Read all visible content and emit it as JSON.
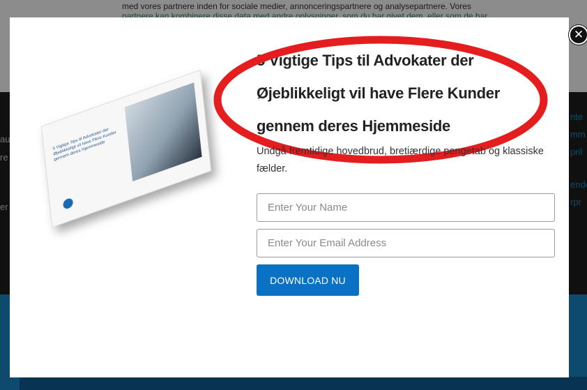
{
  "background": {
    "cookie_text_line1": "",
    "cookie_text_line2": "med vores partnere inden for sociale medier, annonceringspartnere og analysepartnere. Vores",
    "cookie_text_line3": "partnere kan kombinere disse data med andre oplysninger, som du har givet dem, eller som de har",
    "side_left": [
      "au,",
      "re",
      "er e"
    ],
    "side_right": [
      "nte",
      "mm",
      "pril",
      "ende",
      "rpr"
    ]
  },
  "popup": {
    "title": "5 Vigtige Tips til Advokater der Øjeblikkeligt vil have Flere Kunder gennem deres Hjemmeside",
    "subtitle": "Undgå fremtidige hovedbrud, bretiærdige pengetab og klassiske fælder.",
    "name_placeholder": "Enter Your Name",
    "email_placeholder": "Enter Your Email Address",
    "download_label": "DOWNLOAD NU",
    "close_glyph": "✕",
    "ebook_title": "5 Vigtige Tips til Advokater der Øjeblikkeligt vil have Flere Kunder gennem deres Hjemmeside"
  },
  "colors": {
    "accent": "#0a72c2",
    "annotation_red": "#e41e1e",
    "overlay": "rgba(0,0,0,0.45)"
  }
}
